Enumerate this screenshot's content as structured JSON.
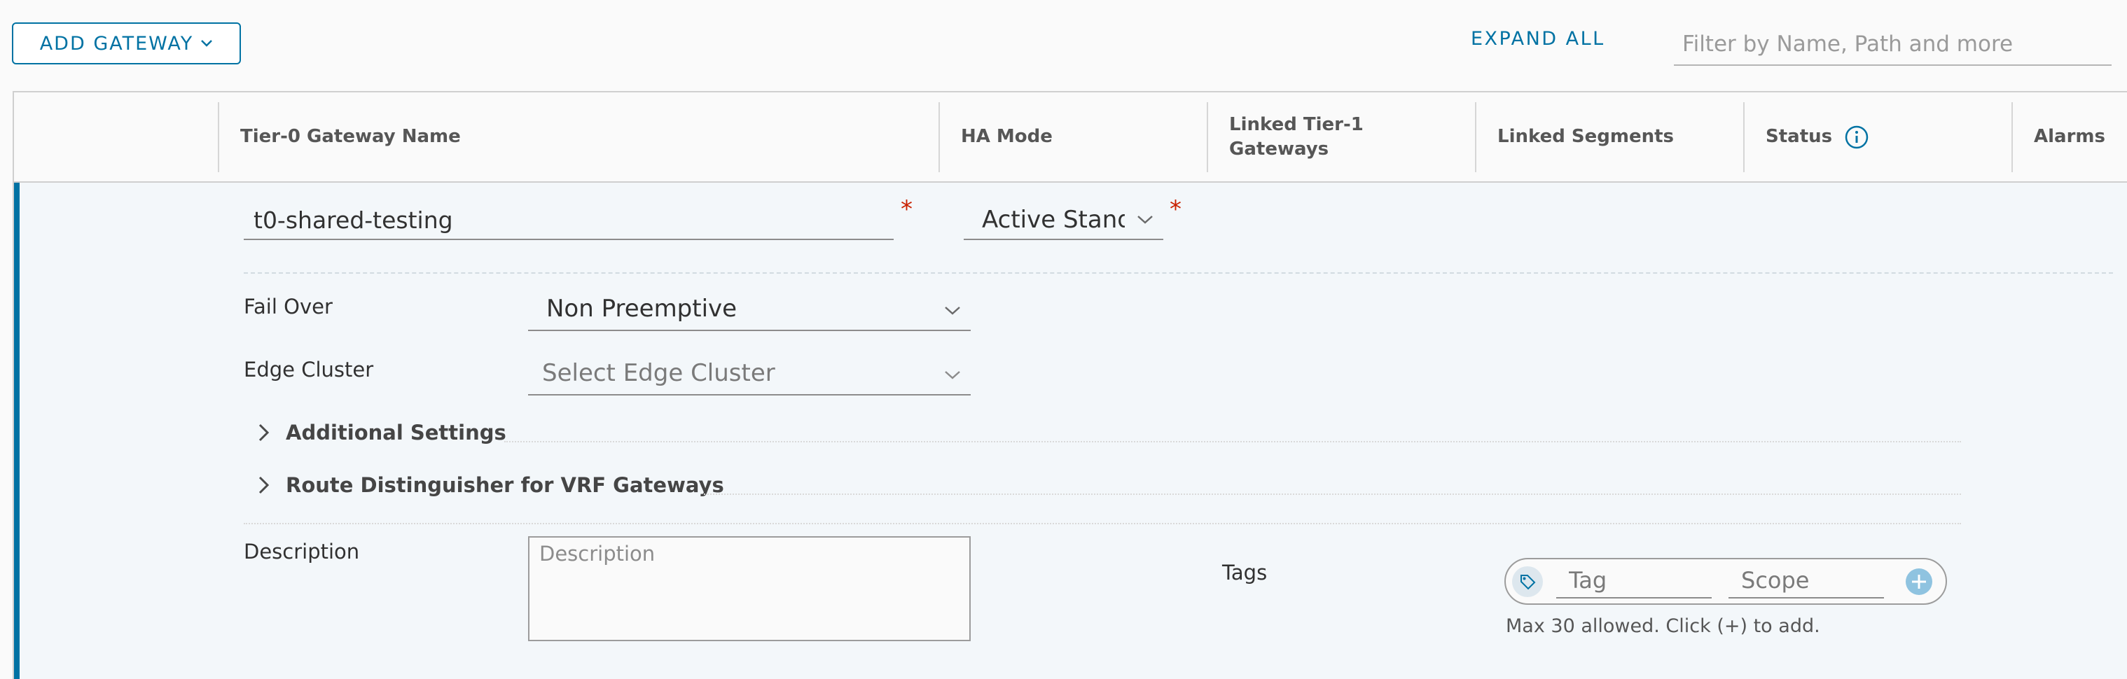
{
  "toolbar": {
    "add_gateway_label": "ADD GATEWAY",
    "expand_all_label": "EXPAND ALL",
    "filter_placeholder": "Filter by Name, Path and more"
  },
  "grid": {
    "columns": {
      "name": "Tier-0 Gateway Name",
      "ha_mode": "HA Mode",
      "linked_tier1": "Linked Tier-1 Gateways",
      "linked_segments": "Linked Segments",
      "status": "Status",
      "alarms": "Alarms"
    },
    "edit_row": {
      "name_value": "t0-shared-testing",
      "ha_mode_value": "Active Standby",
      "required_mark": "*",
      "fail_over": {
        "label": "Fail Over",
        "value": "Non Preemptive"
      },
      "edge_cluster": {
        "label": "Edge Cluster",
        "placeholder": "Select Edge Cluster"
      },
      "sections": {
        "additional_settings": "Additional Settings",
        "route_distinguisher": "Route Distinguisher for VRF Gateways"
      },
      "description": {
        "label": "Description",
        "placeholder": "Description"
      },
      "tags": {
        "label": "Tags",
        "tag_placeholder": "Tag",
        "scope_placeholder": "Scope",
        "hint": "Max 30 allowed. Click (+) to add."
      }
    }
  },
  "icons": {
    "dropdown": "chevron-down-icon",
    "expand": "chevron-right-icon",
    "info": "info-icon",
    "tag": "tag-icon",
    "add": "plus-circle-icon"
  },
  "colors": {
    "accent": "#0072a3",
    "required": "#c92100",
    "row_bg": "#f3f7fa",
    "add_tag_button": "#8fc3e0"
  }
}
